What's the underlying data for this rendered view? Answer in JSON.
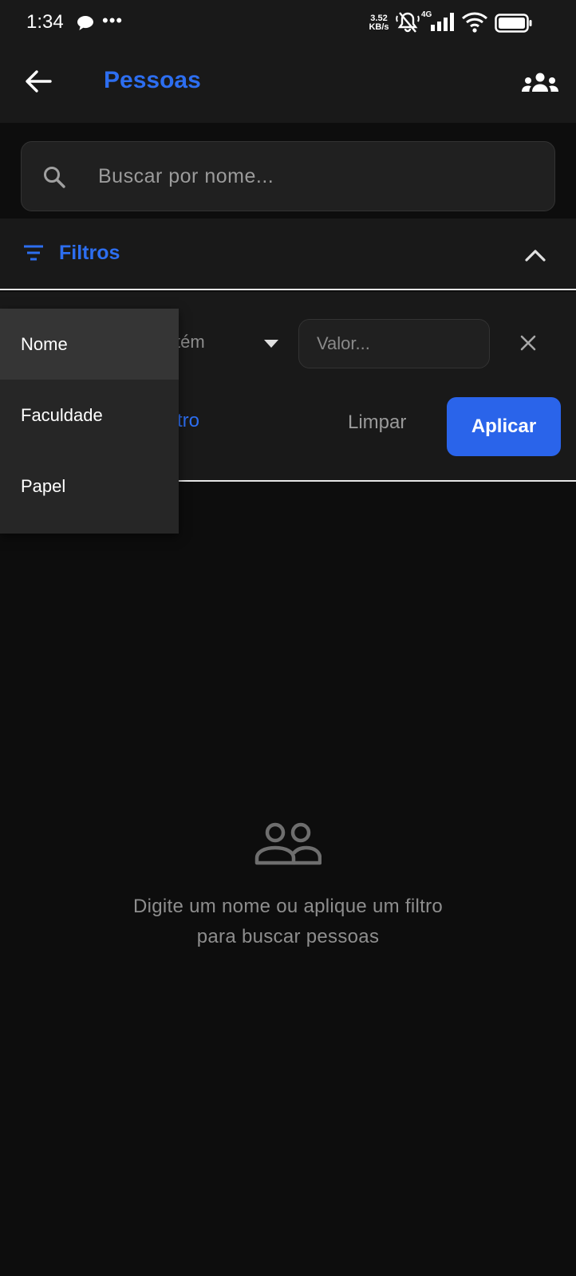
{
  "status_bar": {
    "time": "1:34",
    "more": "•••",
    "speed_value": "3.52",
    "speed_unit": "KB/s",
    "network": "4G"
  },
  "app_bar": {
    "title": "Pessoas"
  },
  "search": {
    "placeholder": "Buscar por nome..."
  },
  "filters": {
    "label": "Filtros",
    "operator_visible": "tém",
    "value_placeholder": "Valor...",
    "add_filter_visible": "tro",
    "clear_label": "Limpar",
    "apply_label": "Aplicar"
  },
  "field_menu": {
    "items": [
      {
        "label": "Nome",
        "selected": true
      },
      {
        "label": "Faculdade",
        "selected": false
      },
      {
        "label": "Papel",
        "selected": false
      }
    ]
  },
  "empty_state": {
    "line1": "Digite um nome ou aplique um filtro",
    "line2": "para buscar pessoas"
  },
  "colors": {
    "accent": "#2d6ef0",
    "apply_button": "#2a64ea",
    "background": "#0d0d0d",
    "surface": "#191919"
  },
  "icons": [
    "back-arrow-icon",
    "groups-icon",
    "search-icon",
    "filter-icon",
    "chevron-up-icon",
    "dropdown-arrow-icon",
    "close-icon",
    "people-outline-icon"
  ]
}
